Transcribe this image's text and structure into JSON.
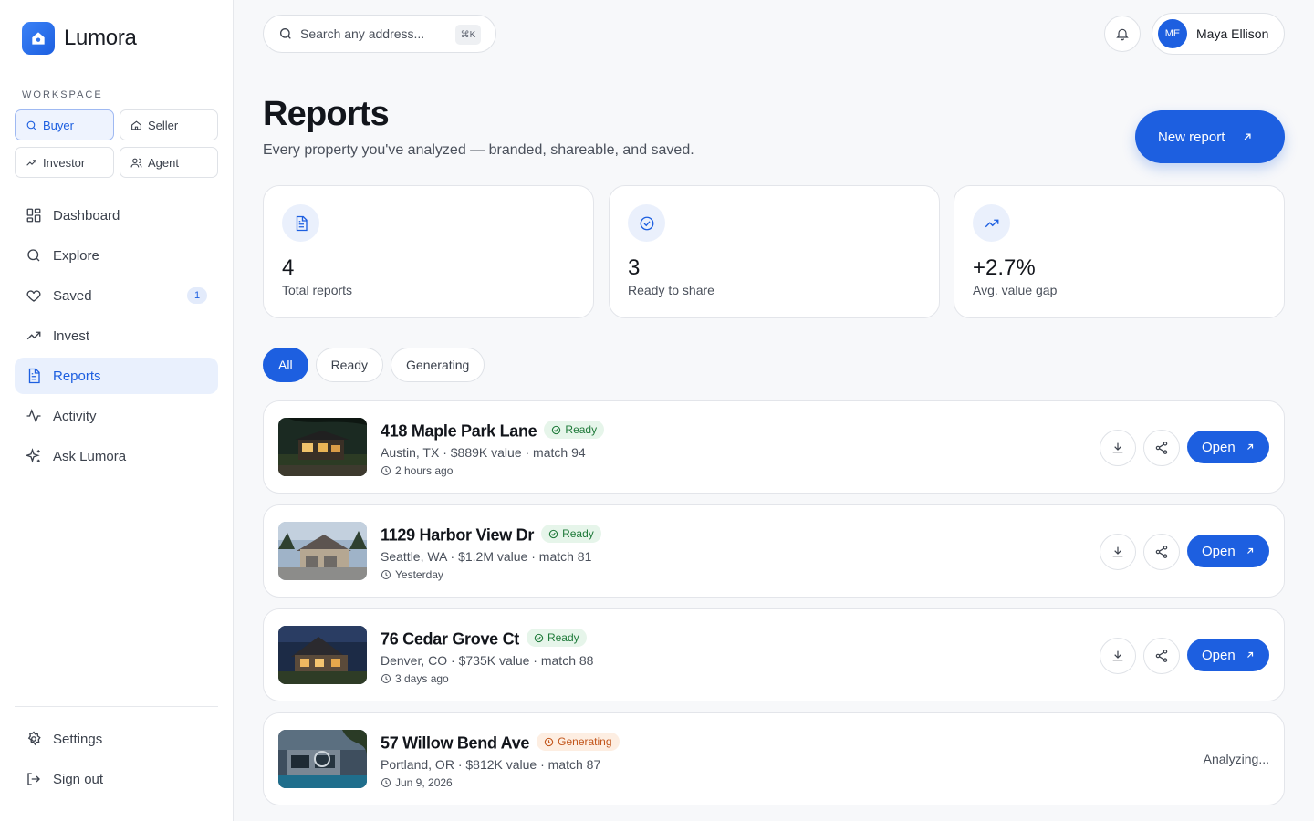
{
  "brand": {
    "name": "Lumora"
  },
  "workspace": {
    "label": "WORKSPACE",
    "modes": [
      {
        "label": "Buyer",
        "icon": "search-icon",
        "active": true
      },
      {
        "label": "Seller",
        "icon": "home-icon",
        "active": false
      },
      {
        "label": "Investor",
        "icon": "trend-icon",
        "active": false
      },
      {
        "label": "Agent",
        "icon": "users-icon",
        "active": false
      }
    ]
  },
  "nav": {
    "items": [
      {
        "label": "Dashboard",
        "icon": "grid-icon"
      },
      {
        "label": "Explore",
        "icon": "search-icon"
      },
      {
        "label": "Saved",
        "icon": "heart-icon",
        "badge": "1"
      },
      {
        "label": "Invest",
        "icon": "trend-icon"
      },
      {
        "label": "Reports",
        "icon": "document-icon",
        "active": true
      },
      {
        "label": "Activity",
        "icon": "pulse-icon"
      },
      {
        "label": "Ask Lumora",
        "icon": "sparkle-icon"
      }
    ],
    "bottom": [
      {
        "label": "Settings",
        "icon": "gear-icon"
      },
      {
        "label": "Sign out",
        "icon": "logout-icon"
      }
    ]
  },
  "header": {
    "search_placeholder": "Search any address...",
    "shortcut": "⌘K",
    "user": {
      "initials": "ME",
      "name": "Maya Ellison"
    }
  },
  "page": {
    "title": "Reports",
    "subtitle": "Every property you've analyzed — branded, shareable, and saved.",
    "new_report_label": "New report"
  },
  "stats": [
    {
      "value": "4",
      "label": "Total reports",
      "icon": "document-icon"
    },
    {
      "value": "3",
      "label": "Ready to share",
      "icon": "check-circle-icon"
    },
    {
      "value": "+2.7%",
      "label": "Avg. value gap",
      "icon": "trend-up-icon"
    }
  ],
  "filters": [
    {
      "label": "All",
      "active": true
    },
    {
      "label": "Ready",
      "active": false
    },
    {
      "label": "Generating",
      "active": false
    }
  ],
  "reports": [
    {
      "title": "418 Maple Park Lane",
      "status": "Ready",
      "meta": "Austin, TX · $889K value · match 94",
      "time": "2 hours ago",
      "open_label": "Open"
    },
    {
      "title": "1129 Harbor View Dr",
      "status": "Ready",
      "meta": "Seattle, WA · $1.2M value · match 81",
      "time": "Yesterday",
      "open_label": "Open"
    },
    {
      "title": "76 Cedar Grove Ct",
      "status": "Ready",
      "meta": "Denver, CO · $735K value · match 88",
      "time": "3 days ago",
      "open_label": "Open"
    },
    {
      "title": "57 Willow Bend Ave",
      "status": "Generating",
      "meta": "Portland, OR · $812K value · match 87",
      "time": "Jun 9, 2026",
      "progress_label": "Analyzing..."
    }
  ],
  "colors": {
    "accent": "#1d5fe0",
    "ready": "#1f7a3a",
    "generating": "#c2561c"
  }
}
